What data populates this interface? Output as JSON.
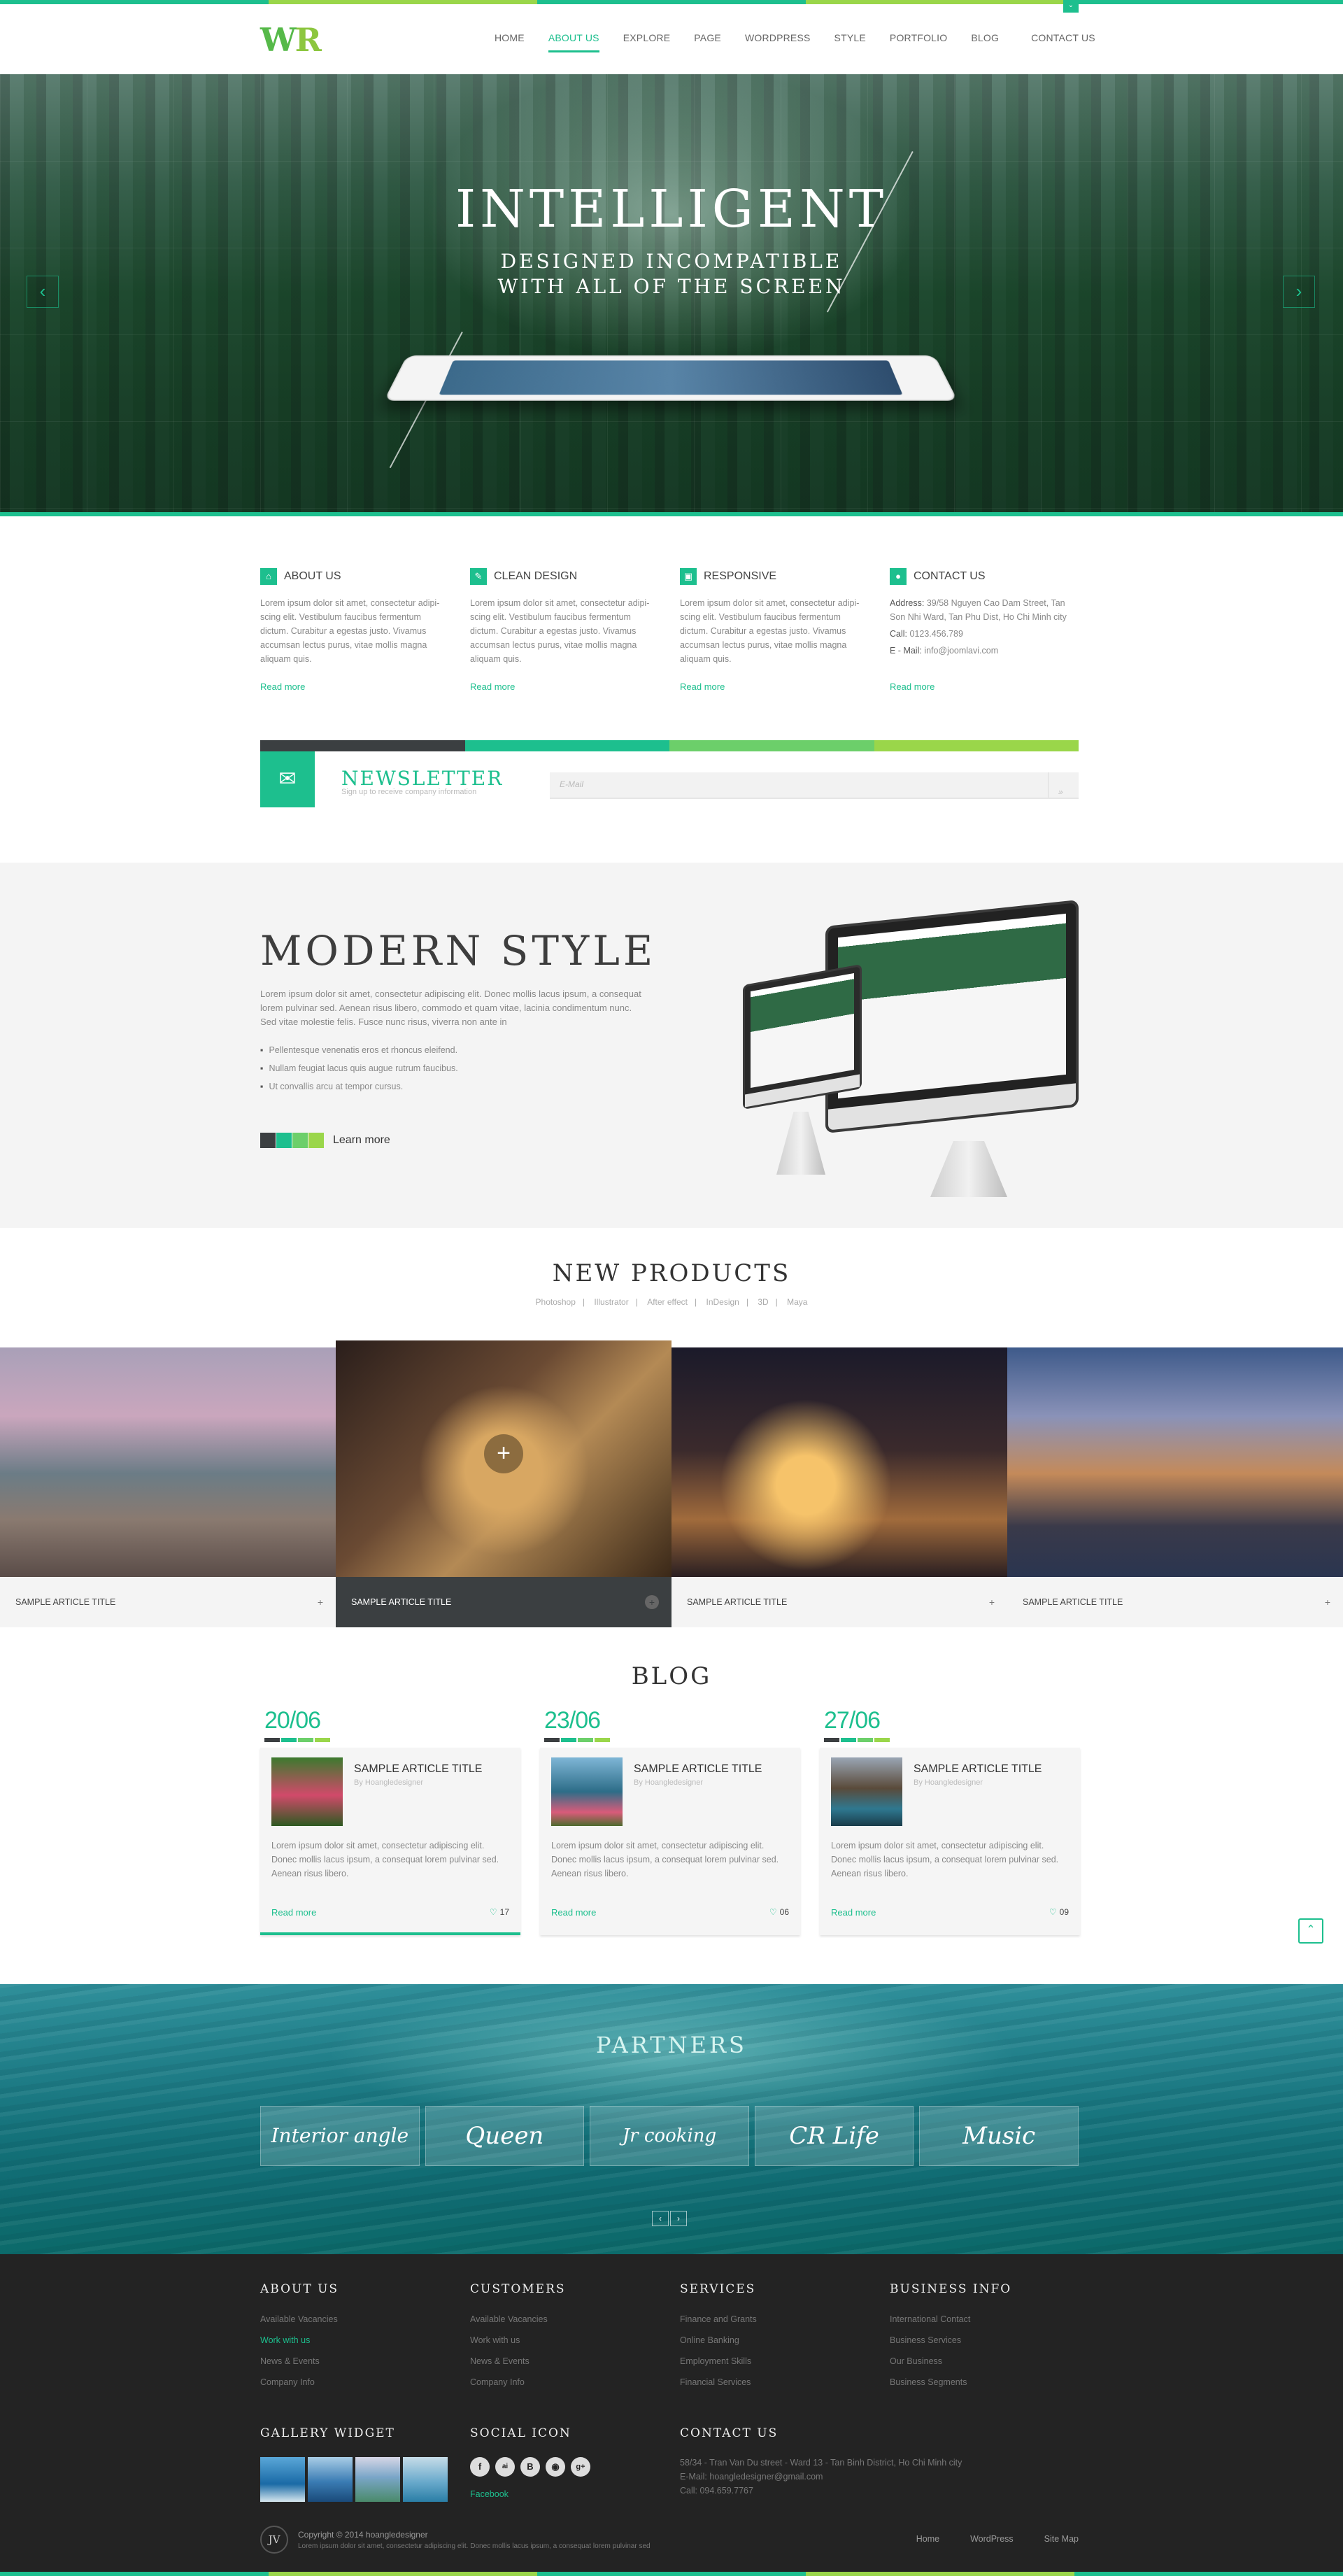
{
  "brand": {
    "logo_main": "W",
    "logo_accent": "R"
  },
  "colors": {
    "accent": "#1dbf8e",
    "accent2": "#9ad64a",
    "dark": "#3b3f41",
    "footer": "#232323"
  },
  "nav": {
    "items": [
      "HOME",
      "ABOUT US",
      "EXPLORE",
      "PAGE",
      "WORDPRESS",
      "STYLE",
      "PORTFOLIO",
      "BLOG",
      "CONTACT US"
    ],
    "active": "ABOUT US"
  },
  "hero": {
    "title": "INTELLIGENT",
    "subtitle_1": "DESIGNED INCOMPATIBLE",
    "subtitle_2": "WITH ALL OF THE SCREEN",
    "prev_icon": "chevron-left-icon",
    "next_icon": "chevron-right-icon"
  },
  "features": [
    {
      "title": "ABOUT US",
      "icon": "home-icon",
      "text": "Lorem ipsum dolor sit amet, consectetur adipi-scing elit. Vestibulum faucibus fermentum dictum. Curabitur a egestas justo. Vivamus accumsan lectus purus, vitae mollis magna aliquam quis.",
      "link": "Read more"
    },
    {
      "title": "CLEAN DESIGN",
      "icon": "pencil-icon",
      "text": "Lorem ipsum dolor sit amet, consectetur adipi-scing elit. Vestibulum faucibus fermentum dictum. Curabitur a egestas justo. Vivamus accumsan lectus purus, vitae mollis magna aliquam quis.",
      "link": "Read more"
    },
    {
      "title": "RESPONSIVE",
      "icon": "monitor-icon",
      "text": "Lorem ipsum dolor sit amet, consectetur adipi-scing elit. Vestibulum faucibus fermentum dictum. Curabitur a egestas justo. Vivamus accumsan lectus purus, vitae mollis magna aliquam quis.",
      "link": "Read more"
    },
    {
      "title": "CONTACT US",
      "icon": "map-pin-icon",
      "address_label": "Address:",
      "address": "39/58 Nguyen Cao Dam Street, Tan Son Nhi Ward, Tan Phu Dist, Ho Chi Minh city",
      "call_label": "Call:",
      "call": "0123.456.789",
      "email_label": "E - Mail:",
      "email": "info@joomlavi.com",
      "link": "Read more"
    }
  ],
  "newsletter": {
    "title": "NEWSLETTER",
    "subtitle": "Sign up to receive company information",
    "placeholder": "E-Mail",
    "icon": "envelope-icon",
    "send_icon": "double-chevron-right-icon"
  },
  "modern": {
    "title": "MODERN STYLE",
    "text": "Lorem ipsum dolor sit amet, consectetur adipiscing elit. Donec mollis lacus ipsum, a consequat lorem pulvinar sed. Aenean risus libero, commodo et quam vitae, lacinia condimentum nunc. Sed vitae molestie felis. Fusce nunc risus, viverra non ante in",
    "bullets": [
      "Pellentesque venenatis eros et rhoncus eleifend.",
      "Nullam feugiat lacus quis augue rutrum faucibus.",
      "Ut convallis arcu at tempor cursus."
    ],
    "button": "Learn more"
  },
  "products": {
    "title": "NEW PRODUCTS",
    "filters": [
      "Photoshop",
      "Illustrator",
      "After effect",
      "InDesign",
      "3D",
      "Maya"
    ],
    "items": [
      {
        "title": "SAMPLE ARTICLE TITLE"
      },
      {
        "title": "SAMPLE ARTICLE TITLE"
      },
      {
        "title": "SAMPLE ARTICLE TITLE"
      },
      {
        "title": "SAMPLE ARTICLE TITLE"
      }
    ]
  },
  "blog": {
    "title": "BLOG",
    "posts": [
      {
        "date": "20/06",
        "title": "SAMPLE ARTICLE TITLE",
        "author": "By Hoangledesigner",
        "text": "Lorem ipsum dolor sit amet, consectetur adipiscing elit. Donec mollis lacus ipsum, a consequat lorem pulvinar sed. Aenean risus libero.",
        "link": "Read more",
        "likes": "17"
      },
      {
        "date": "23/06",
        "title": "SAMPLE ARTICLE TITLE",
        "author": "By Hoangledesigner",
        "text": "Lorem ipsum dolor sit amet, consectetur adipiscing elit. Donec mollis lacus ipsum, a consequat lorem pulvinar sed. Aenean risus libero.",
        "link": "Read more",
        "likes": "06"
      },
      {
        "date": "27/06",
        "title": "SAMPLE ARTICLE TITLE",
        "author": "By Hoangledesigner",
        "text": "Lorem ipsum dolor sit amet, consectetur adipiscing elit. Donec mollis lacus ipsum, a consequat lorem pulvinar sed. Aenean risus libero.",
        "link": "Read more",
        "likes": "09"
      }
    ]
  },
  "partners": {
    "title": "PARTNERS",
    "logos": [
      "Interior angle",
      "Queen",
      "Jr cooking",
      "CR Life",
      "Music"
    ]
  },
  "footer": {
    "about": {
      "title": "ABOUT US",
      "items": [
        "Available Vacancies",
        "Work with us",
        "News & Events",
        "Company Info"
      ]
    },
    "customers": {
      "title": "CUSTOMERS",
      "items": [
        "Available Vacancies",
        "Work with us",
        "News & Events",
        "Company Info"
      ]
    },
    "services": {
      "title": "SERVICES",
      "items": [
        "Finance and Grants",
        "Online Banking",
        "Employment Skills",
        "Financial Services"
      ]
    },
    "business": {
      "title": "BUSINESS INFO",
      "items": [
        "International Contact",
        "Business Services",
        "Our Business",
        "Business Segments"
      ]
    },
    "gallery_title": "GALLERY WIDGET",
    "social_title": "SOCIAL ICON",
    "social_icons": [
      "f",
      "ai",
      "B",
      "◉",
      "g+"
    ],
    "social_label": "Facebook",
    "contact_title": "CONTACT US",
    "contact_lines": [
      "58/34 - Tran Van Du street - Ward 13 - Tan Binh District, Ho Chi Minh city",
      "E-Mail: hoangledesigner@gmail.com",
      "Call: 094.659.7767"
    ],
    "badge": "JV",
    "copyright": "Copyright © 2014 hoangledesigner",
    "copyright_sub": "Lorem ipsum dolor sit amet, consectetur adipiscing elit. Donec mollis lacus ipsum, a consequat lorem pulvinar sed",
    "links": [
      "Home",
      "WordPress",
      "Site Map"
    ]
  }
}
